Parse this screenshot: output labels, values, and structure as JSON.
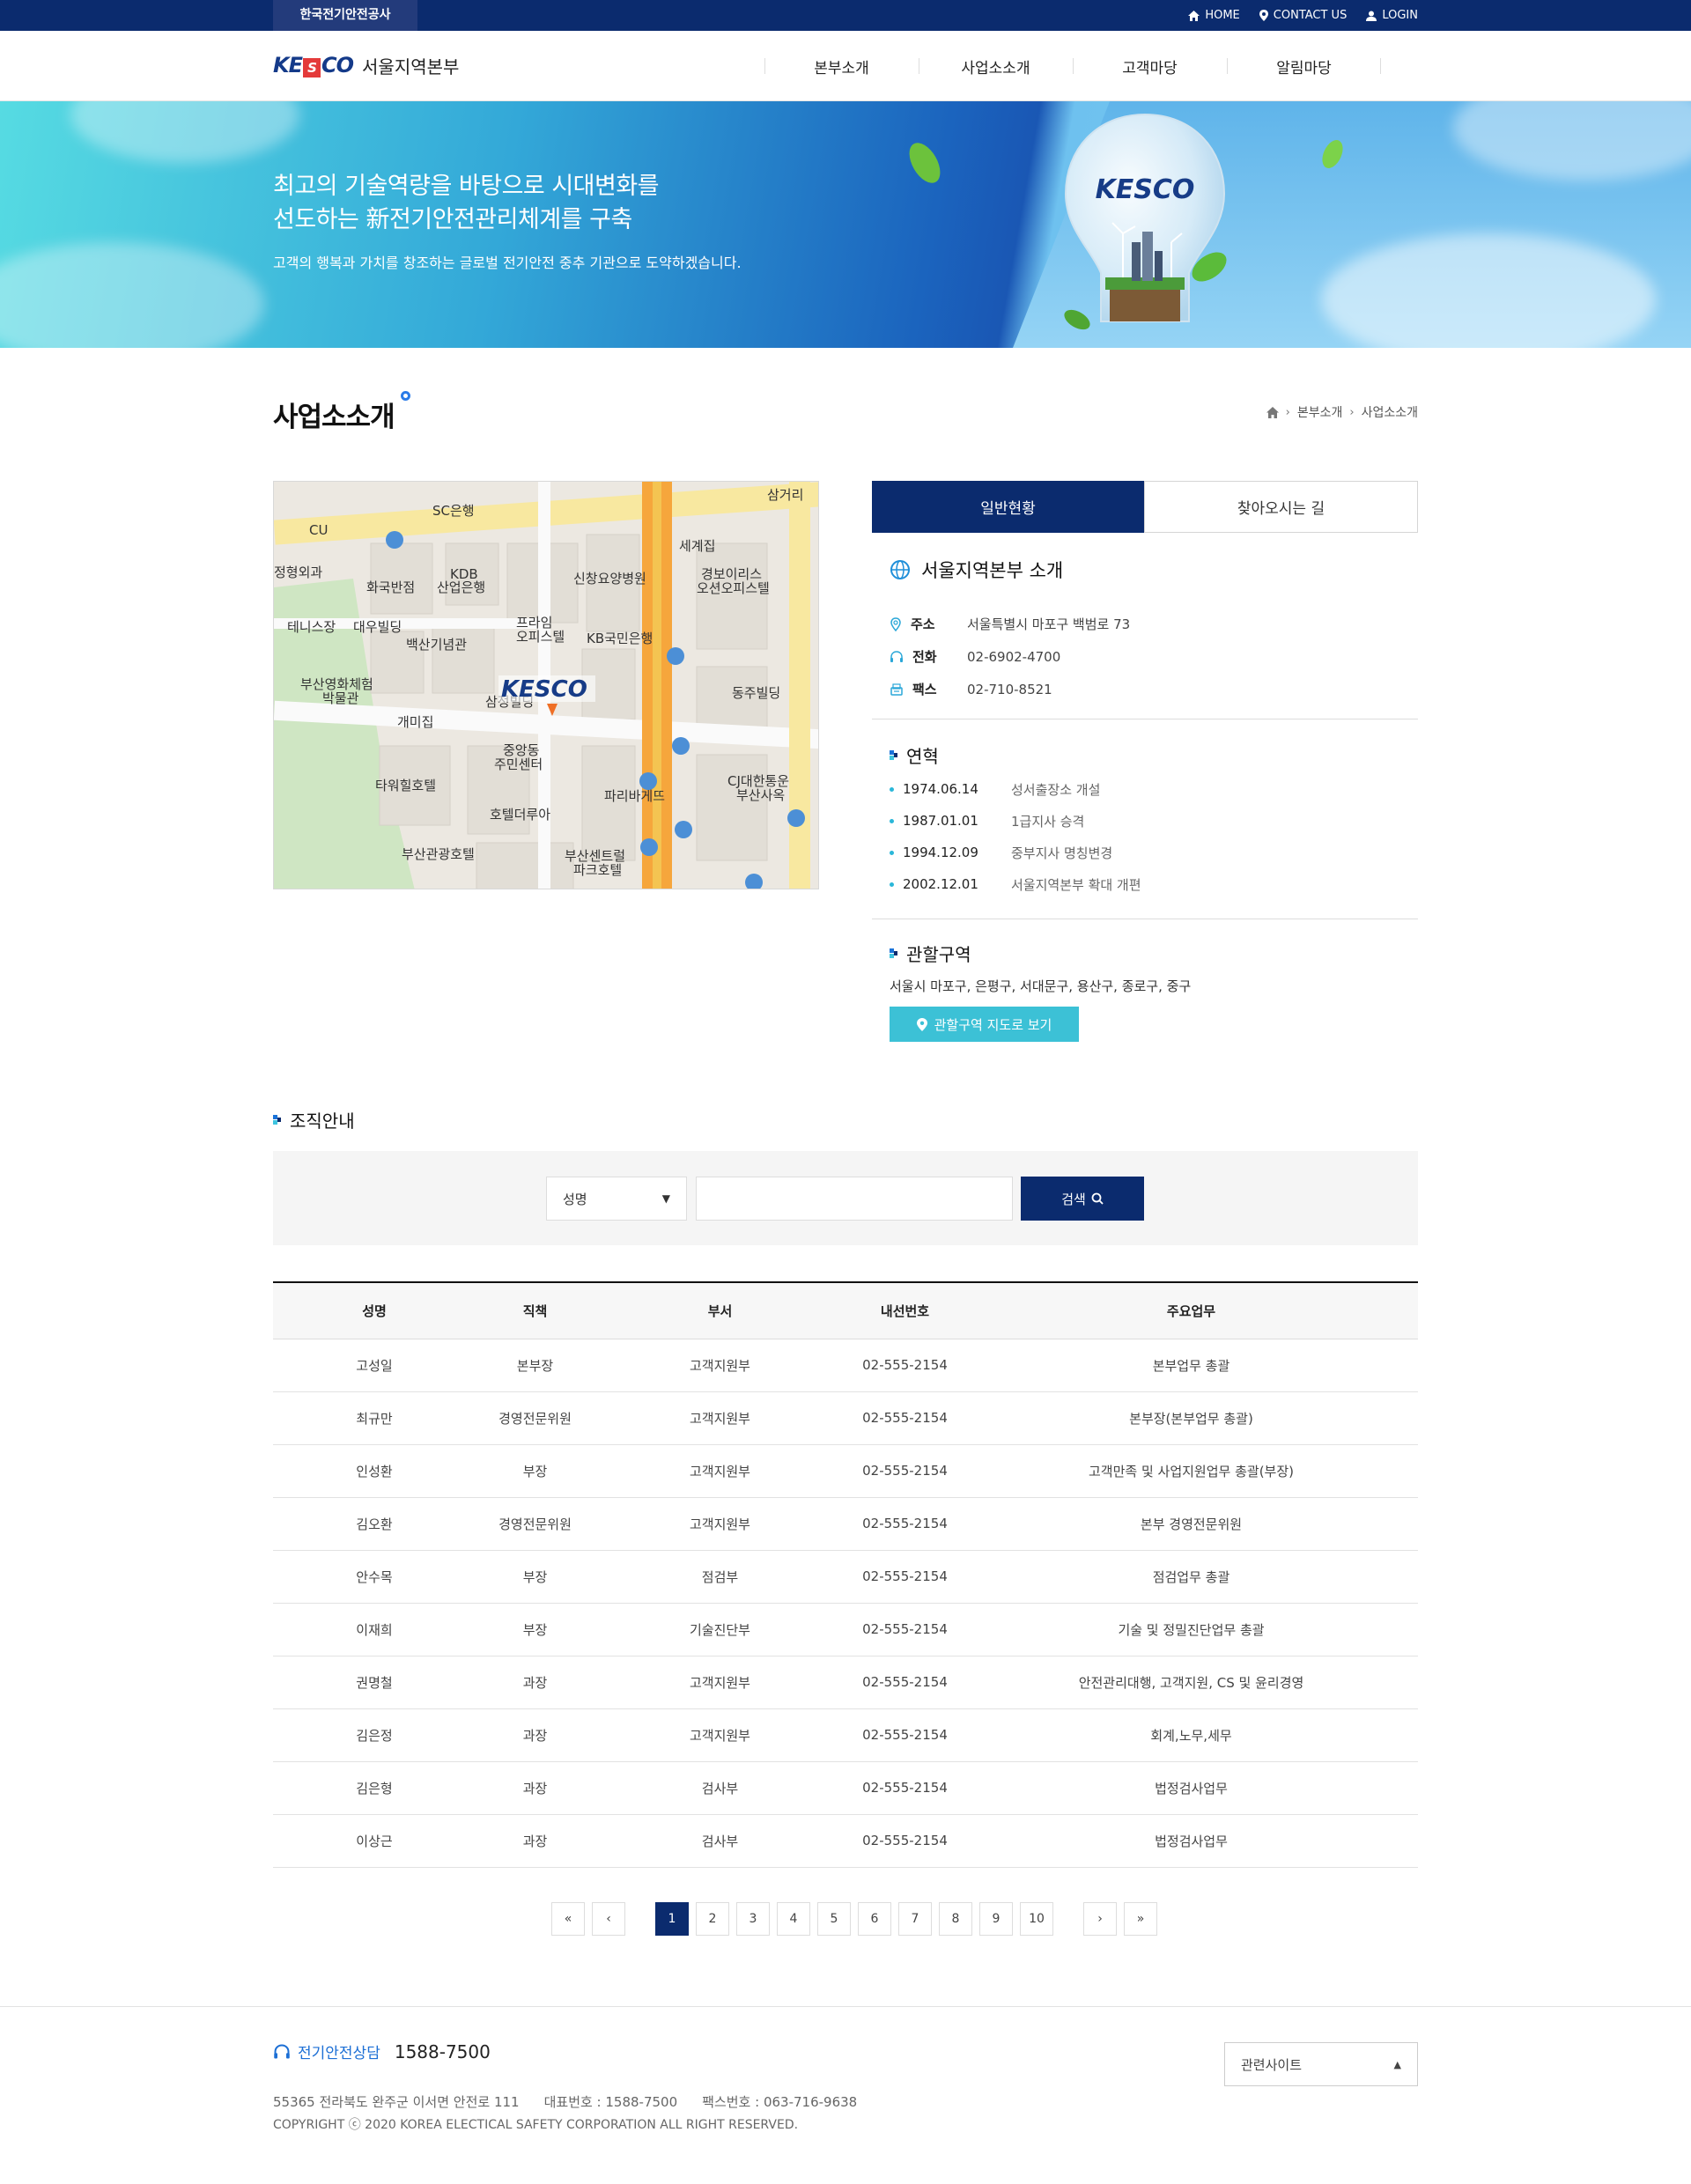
{
  "topbar": {
    "org_label": "한국전기안전공사",
    "links": {
      "home": "HOME",
      "contact": "CONTACT US",
      "login": "LOGIN"
    }
  },
  "header": {
    "logo_text": "KESCO",
    "site_title": "서울지역본부",
    "nav": [
      "본부소개",
      "사업소소개",
      "고객마당",
      "알림마당"
    ]
  },
  "hero": {
    "headline_1": "최고의 기술역량을 바탕으로 시대변화를",
    "headline_2": "선도하는 新전기안전관리체계를 구축",
    "sub": "고객의 행복과 가치를 창조하는 글로벌 전기안전 중추 기관으로 도약하겠습니다.",
    "bulb_logo": "KESCO"
  },
  "page": {
    "title": "사업소소개",
    "breadcrumb": [
      "본부소개",
      "사업소소개"
    ]
  },
  "map": {
    "logo": "KESCO",
    "labels": [
      "CU",
      "SC은행",
      "KDB",
      "산업은행",
      "화국반점",
      "대우빌딩",
      "프라임",
      "오피스텔",
      "KB국민은행",
      "신창요양병원",
      "경보이리스",
      "오션오피스텔",
      "백산기념관",
      "부산영화체험",
      "박물관",
      "삼정빌딩",
      "개미집",
      "중앙동",
      "주민센터",
      "타워힐호텔",
      "호텔더루아",
      "파리바게뜨",
      "CJ대한통운",
      "부산사옥",
      "동주빌딩",
      "부산관광호텔",
      "부산센트럴",
      "파크호텔",
      "테니스장",
      "정형외과",
      "세계집",
      "삼거리"
    ]
  },
  "tabs": {
    "active": "일반현황",
    "inactive": "찾아오시는 길"
  },
  "intro": {
    "title": "서울지역본부 소개",
    "rows": [
      {
        "key": "주소",
        "value": "서울특별시 마포구 백범로 73",
        "icon": "location-pin-icon"
      },
      {
        "key": "전화",
        "value": "02-6902-4700",
        "icon": "headset-icon"
      },
      {
        "key": "팩스",
        "value": "02-710-8521",
        "icon": "fax-icon"
      }
    ]
  },
  "history": {
    "title": "연혁",
    "items": [
      {
        "date": "1974.06.14",
        "desc": "성서출장소 개설"
      },
      {
        "date": "1987.01.01",
        "desc": "1급지사 승격"
      },
      {
        "date": "1994.12.09",
        "desc": "중부지사 명칭변경"
      },
      {
        "date": "2002.12.01",
        "desc": "서울지역본부 확대 개편"
      }
    ]
  },
  "region": {
    "title": "관할구역",
    "text": "서울시 마포구, 은평구, 서대문구, 용산구, 종로구, 중구",
    "button": "관할구역 지도로 보기"
  },
  "org": {
    "title": "조직안내",
    "select_value": "성명",
    "input_value": "",
    "search_button": "검색",
    "columns": [
      "성명",
      "직책",
      "부서",
      "내선번호",
      "주요업무"
    ],
    "rows": [
      [
        "고성일",
        "본부장",
        "고객지원부",
        "02-555-2154",
        "본부업무 총괄"
      ],
      [
        "최규만",
        "경영전문위원",
        "고객지원부",
        "02-555-2154",
        "본부장(본부업무 총괄)"
      ],
      [
        "인성환",
        "부장",
        "고객지원부",
        "02-555-2154",
        "고객만족 및 사업지원업무 총괄(부장)"
      ],
      [
        "김오환",
        "경영전문위원",
        "고객지원부",
        "02-555-2154",
        "본부 경영전문위원"
      ],
      [
        "안수목",
        "부장",
        "점검부",
        "02-555-2154",
        "점검업무 총괄"
      ],
      [
        "이재희",
        "부장",
        "기술진단부",
        "02-555-2154",
        "기술 및 정밀진단업무 총괄"
      ],
      [
        "권명철",
        "과장",
        "고객지원부",
        "02-555-2154",
        "안전관리대행, 고객지원, CS 및 윤리경영"
      ],
      [
        "김은정",
        "과장",
        "고객지원부",
        "02-555-2154",
        "회계,노무,세무"
      ],
      [
        "김은형",
        "과장",
        "검사부",
        "02-555-2154",
        "법정검사업무"
      ],
      [
        "이상근",
        "과장",
        "검사부",
        "02-555-2154",
        "법정검사업무"
      ]
    ]
  },
  "pagination": {
    "first": "«",
    "prev": "‹",
    "next": "›",
    "last": "»",
    "pages": [
      "1",
      "2",
      "3",
      "4",
      "5",
      "6",
      "7",
      "8",
      "9",
      "10"
    ],
    "current": "1"
  },
  "footer": {
    "call_label": "전기안전상담",
    "call_number": "1588-7500",
    "address": "55365 전라북도 완주군 이서면 안전로 111",
    "main_phone": "대표번호 : 1588-7500",
    "fax": "팩스번호 : 063-716-9638",
    "copyright": "COPYRIGHT ⓒ 2020 KOREA ELECTICAL SAFETY CORPORATION ALL RIGHT RESERVED.",
    "related_sites": "관련사이트"
  },
  "colors": {
    "navy": "#0b2b6e",
    "accent_blue": "#1c6fd5",
    "teal_button": "#3cc1d6"
  }
}
